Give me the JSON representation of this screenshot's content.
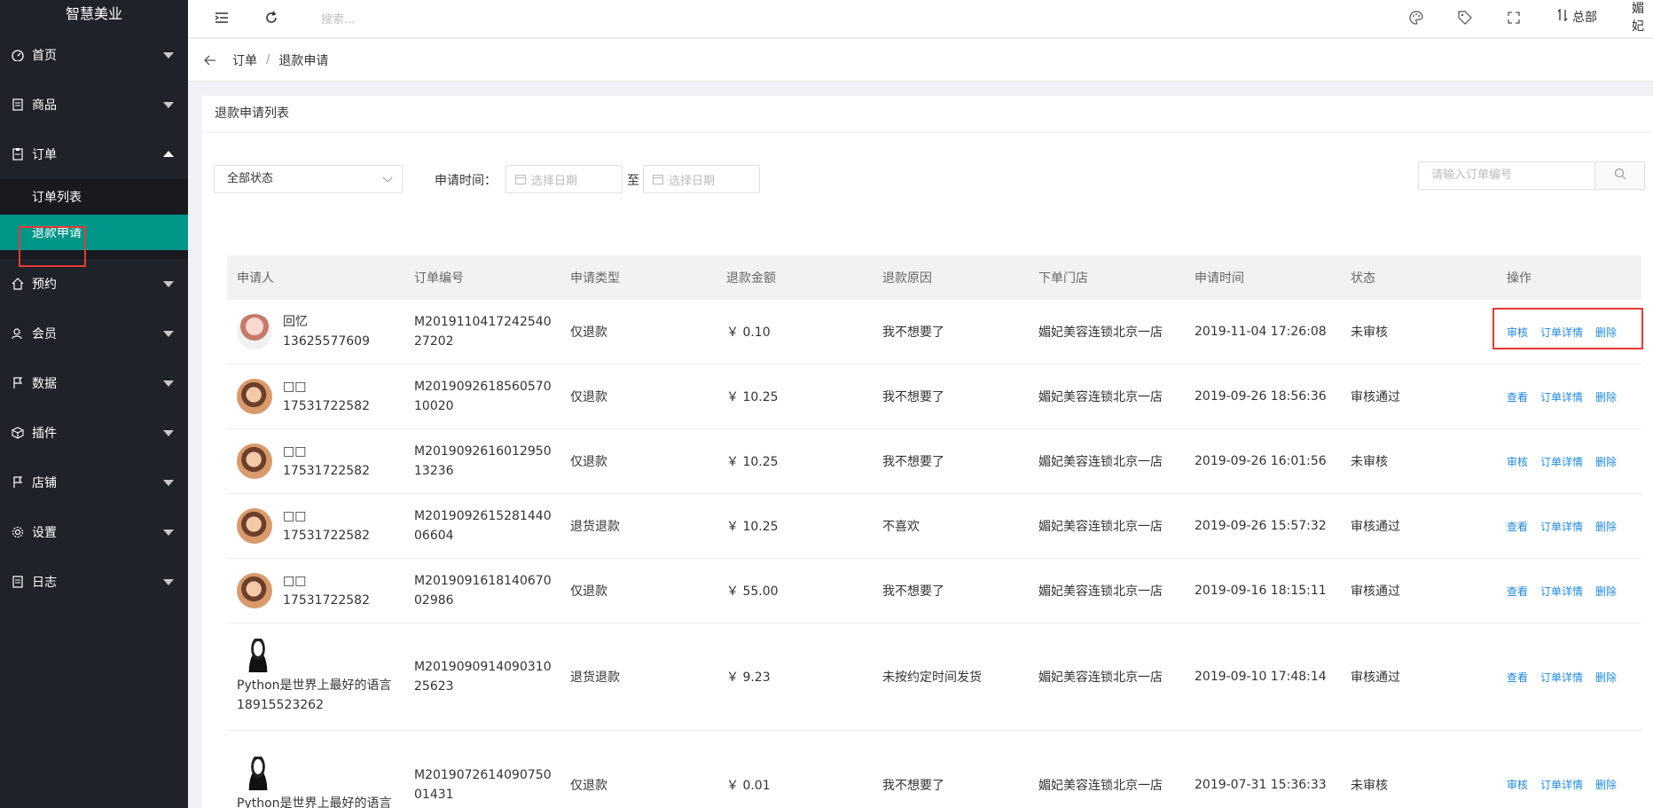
{
  "app": {
    "title": "智慧美业"
  },
  "sidebar": {
    "items": [
      {
        "label": "首页",
        "icon": "dashboard-icon"
      },
      {
        "label": "商品",
        "icon": "goods-icon"
      },
      {
        "label": "订单",
        "icon": "order-icon",
        "expanded": true,
        "children": [
          {
            "label": "订单列表"
          },
          {
            "label": "退款申请",
            "active": true
          }
        ]
      },
      {
        "label": "预约",
        "icon": "home-icon"
      },
      {
        "label": "会员",
        "icon": "member-icon"
      },
      {
        "label": "数据",
        "icon": "flag-icon"
      },
      {
        "label": "插件",
        "icon": "cube-icon"
      },
      {
        "label": "店铺",
        "icon": "flag-icon"
      },
      {
        "label": "设置",
        "icon": "gear-icon"
      },
      {
        "label": "日志",
        "icon": "log-icon"
      }
    ]
  },
  "header": {
    "search_placeholder": "搜索...",
    "store_switch": "总部",
    "user": "媚妃"
  },
  "breadcrumb": {
    "parent": "订单",
    "sep": "/",
    "current": "退款申请"
  },
  "card": {
    "title": "退款申请列表"
  },
  "filters": {
    "status": "全部状态",
    "date_label": "申请时间：",
    "start_placeholder": "选择日期",
    "to": "至",
    "end_placeholder": "选择日期",
    "order_search_placeholder": "请输入订单编号"
  },
  "table": {
    "headers": [
      "申请人",
      "订单编号",
      "申请类型",
      "退款金额",
      "退款原因",
      "下单门店",
      "申请时间",
      "状态",
      "操作"
    ],
    "rows": [
      {
        "name": "回忆",
        "phone": "13625577609",
        "order": "M201911041724254027202",
        "type": "仅退款",
        "amount": "￥ 0.10",
        "reason": "我不想要了",
        "store": "媚妃美容连锁北京一店",
        "time": "2019-11-04 17:26:08",
        "status": "未审核",
        "op1": "审核",
        "op2": "订单详情",
        "op3": "删除"
      },
      {
        "name": "□□",
        "phone": "17531722582",
        "order": "M201909261856057010020",
        "type": "仅退款",
        "amount": "￥ 10.25",
        "reason": "我不想要了",
        "store": "媚妃美容连锁北京一店",
        "time": "2019-09-26 18:56:36",
        "status": "审核通过",
        "op1": "查看",
        "op2": "订单详情",
        "op3": "删除"
      },
      {
        "name": "□□",
        "phone": "17531722582",
        "order": "M201909261601295013236",
        "type": "仅退款",
        "amount": "￥ 10.25",
        "reason": "我不想要了",
        "store": "媚妃美容连锁北京一店",
        "time": "2019-09-26 16:01:56",
        "status": "未审核",
        "op1": "审核",
        "op2": "订单详情",
        "op3": "删除"
      },
      {
        "name": "□□",
        "phone": "17531722582",
        "order": "M201909261528144006604",
        "type": "退货退款",
        "amount": "￥ 10.25",
        "reason": "不喜欢",
        "store": "媚妃美容连锁北京一店",
        "time": "2019-09-26 15:57:32",
        "status": "审核通过",
        "op1": "查看",
        "op2": "订单详情",
        "op3": "删除"
      },
      {
        "name": "□□",
        "phone": "17531722582",
        "order": "M201909161814067002986",
        "type": "仅退款",
        "amount": "￥ 55.00",
        "reason": "我不想要了",
        "store": "媚妃美容连锁北京一店",
        "time": "2019-09-16 18:15:11",
        "status": "审核通过",
        "op1": "查看",
        "op2": "订单详情",
        "op3": "删除"
      },
      {
        "name": "Python是世界上最好的语言",
        "phone": "18915523262",
        "order": "M201909091409031025623",
        "type": "退货退款",
        "amount": "￥ 9.23",
        "reason": "未按约定时间发货",
        "store": "媚妃美容连锁北京一店",
        "time": "2019-09-10 17:48:14",
        "status": "审核通过",
        "op1": "查看",
        "op2": "订单详情",
        "op3": "删除"
      },
      {
        "name": "Python是世界上最好的语言",
        "phone": "",
        "order": "M201907261409075001431",
        "type": "仅退款",
        "amount": "￥ 0.01",
        "reason": "我不想要了",
        "store": "媚妃美容连锁北京一店",
        "time": "2019-07-31 15:36:33",
        "status": "未审核",
        "op1": "审核",
        "op2": "订单详情",
        "op3": "删除"
      }
    ]
  }
}
